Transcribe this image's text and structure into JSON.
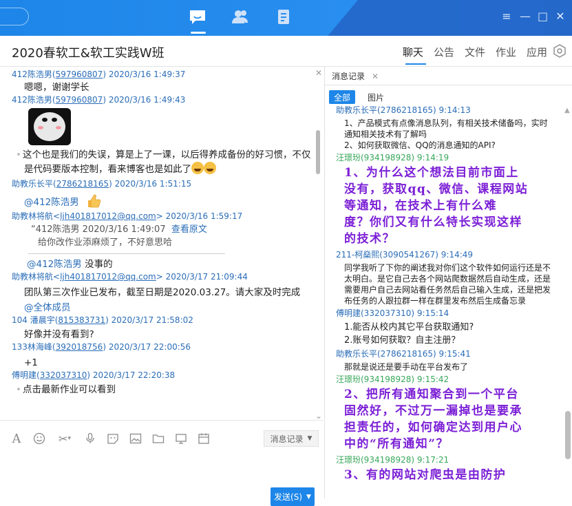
{
  "topbar": {
    "icons": [
      "chat-bubble-icon",
      "contacts-icon",
      "document-icon"
    ],
    "window_controls": [
      "≡",
      "—",
      "□",
      "✕"
    ]
  },
  "header": {
    "title": "2020春软工&软工实践W班",
    "tabs": [
      "聊天",
      "公告",
      "文件",
      "作业",
      "应用"
    ],
    "active_tab": "聊天"
  },
  "chat": {
    "messages": [
      {
        "sender": "412陈浩男",
        "qq": "597960807",
        "time": "2020/3/16 1:49:37",
        "text": "嗯嗯，谢谢学长"
      },
      {
        "sender": "412陈浩男",
        "qq": "597960807",
        "time": "2020/3/16 1:49:43",
        "image": "panda-meme-image"
      },
      {
        "text": "这个也是我们的失误，算是上了一课，以后得养成备份的好习惯，不仅是代码要版本控制，看来博客也是如此了"
      },
      {
        "sender": "助教乐长平",
        "qq": "2786218165",
        "time": "2020/3/16 1:51:15",
        "mention": "@412陈浩男"
      },
      {
        "sender": "助教林将航",
        "qq": "ljh401817012@qq.com",
        "time": "2020/3/16 1:59:17",
        "quote_head": "“412陈浩男  2020/3/16 1:49:07",
        "quote_link": "查看原文",
        "quote_text": "给你改作业添麻烦了，不好意思哈",
        "mention": "@412陈浩男",
        "text": "没事的"
      },
      {
        "sender": "助教林将航",
        "qq": "ljh401817012@qq.com",
        "time": "2020/3/17 21:09:44",
        "text": "团队第三次作业已发布，截至日期是2020.03.27。请大家及时完成",
        "mention": "@全体成员"
      },
      {
        "sender": "104 潘晨宇",
        "qq": "815383731",
        "time": "2020/3/17 21:58:02",
        "text": "好像并没有看到?"
      },
      {
        "sender": "133林海峰",
        "qq": "392018756",
        "time": "2020/3/17 22:00:56",
        "text": "+1"
      },
      {
        "sender": "傅明建",
        "qq": "332037310",
        "time": "2020/3/17 22:20:38",
        "text": "点击最新作业可以看到"
      }
    ]
  },
  "input": {
    "tools": [
      "font-icon",
      "emoji-icon",
      "scissors-icon",
      "mic-icon",
      "sticker-icon",
      "image-icon",
      "folder-icon",
      "screen-share-icon",
      "calendar-icon"
    ],
    "history_label": "消息记录",
    "send_label": "发送(S)"
  },
  "history": {
    "tab_label": "消息记录",
    "filter_all": "全部",
    "filter_images": "图片",
    "items": [
      {
        "head": "助教乐长平(2786218165) 9:14:13",
        "color": "blue",
        "lines": [
          "1、产品模式有点像消息队列，有相关技术储备吗，实时",
          "通知相关技术有了解吗",
          "2、如何获取微信、QQ的消息通知的API?"
        ]
      },
      {
        "head": "汪璟玢(934198928) 9:14:19",
        "color": "green",
        "big": [
          "1、为什么这个想法目前市面上",
          "没有，获取qq、微信、课程网站",
          "等通知，在技术上有什么难",
          "度？你们又有什么特长实现这样",
          "的技术？"
        ]
      },
      {
        "head": "211-柯燊熙(3090541267) 9:14:49",
        "color": "blue",
        "lines": [
          "同学我听了下你的阐述我对你们这个软件如何运行还是不",
          "太明白。是它自己去各个网站爬数据然后自动生成，还是",
          "需要用户自己去网站看任务然后自己输入生成，还是把发",
          "布任务的人跟拉群一样在群里发布然后生成备忘录"
        ]
      },
      {
        "head": "傅明建(332037310) 9:15:14",
        "color": "blue",
        "lines": [
          "1.能否从校内其它平台获取通知?",
          "2.账号如何获取？自主注册？"
        ]
      },
      {
        "head": "助教乐长平(2786218165) 9:15:41",
        "color": "blue",
        "lines": [
          "那就是说还是要手动在平台发布了"
        ]
      },
      {
        "head": "汪璟玢(934198928) 9:15:42",
        "color": "green",
        "big": [
          "2、把所有通知聚合到一个平台",
          "固然好，不过万一漏掉也是要承",
          "担责任的，如何确定达到用户心",
          "中的“所有通知”？"
        ]
      },
      {
        "head": "汪璟玢(934198928) 9:17:21",
        "color": "green",
        "big": [
          "3、有的网站对爬虫是由防护"
        ]
      }
    ]
  }
}
